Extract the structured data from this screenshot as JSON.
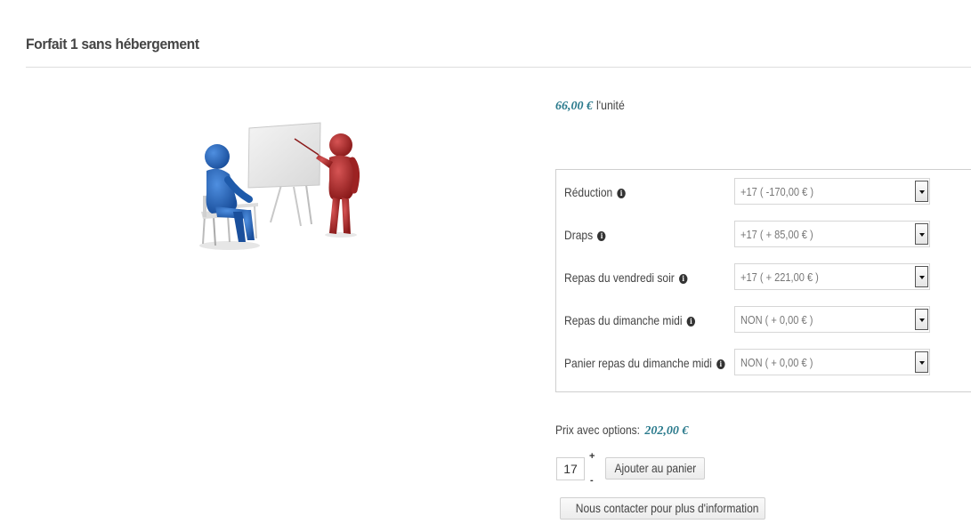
{
  "product": {
    "title": "Forfait 1 sans hébergement",
    "unit_price": "66,00 €",
    "unit_suffix": "l'unité"
  },
  "options": [
    {
      "label": "Réduction",
      "value": "+17 ( -170,00 € )"
    },
    {
      "label": "Draps",
      "value": "+17 ( + 85,00 € )"
    },
    {
      "label": "Repas du vendredi soir",
      "value": "+17 ( + 221,00 € )"
    },
    {
      "label": "Repas du dimanche midi",
      "value": "NON ( + 0,00 € )"
    },
    {
      "label": "Panier repas du dimanche midi",
      "value": "NON ( + 0,00 € )"
    }
  ],
  "total": {
    "label": "Prix avec options:",
    "price": "202,00 €"
  },
  "quantity": {
    "value": "17",
    "increment": "+",
    "decrement": "-"
  },
  "buttons": {
    "add_to_cart": "Ajouter au panier",
    "contact": "Nous contacter pour plus d'information"
  },
  "icons": {
    "info": "info-icon"
  },
  "colors": {
    "price": "#2a7a8c"
  }
}
